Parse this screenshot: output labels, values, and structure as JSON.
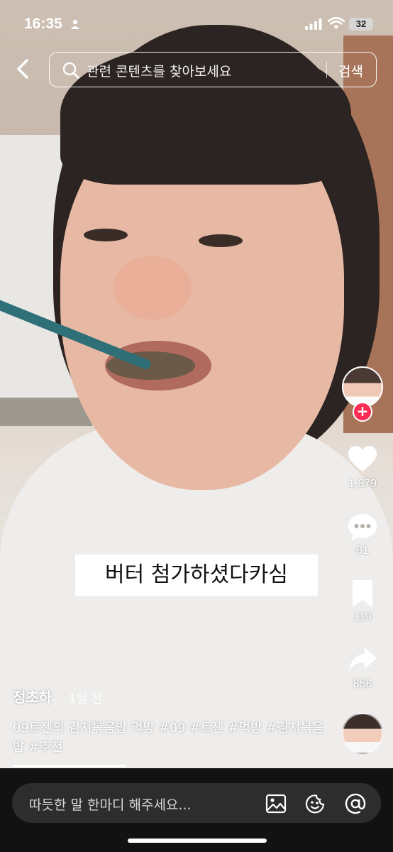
{
  "status_bar": {
    "time": "16:35",
    "battery": "32"
  },
  "search": {
    "placeholder": "관련 콘텐츠를 찾아보세요",
    "button_label": "검색"
  },
  "video": {
    "caption": "버터 첨가하셨다카심"
  },
  "actions": {
    "likes": "1,879",
    "comments": "81",
    "saves": "119",
    "shares": "856"
  },
  "post": {
    "author": "정초하",
    "posted": "· 1일 전",
    "description": "09트젠의 김치볶음밥 먹방 #09 #트젠 #먹방 #김치볶음밥 #추천"
  },
  "comment_bar": {
    "placeholder": "따듯한 말 한마디 해주세요..."
  },
  "colors": {
    "accent_follow": "#fe2c55",
    "bottom_bar": "#121212",
    "comment_field": "#2d2d2d"
  },
  "icons": [
    "person-icon",
    "signal-icon",
    "wifi-icon",
    "battery-icon",
    "back-icon",
    "search-icon",
    "heart-icon",
    "comment-icon",
    "bookmark-icon",
    "share-icon",
    "image-icon",
    "emoji-icon",
    "mention-icon"
  ]
}
